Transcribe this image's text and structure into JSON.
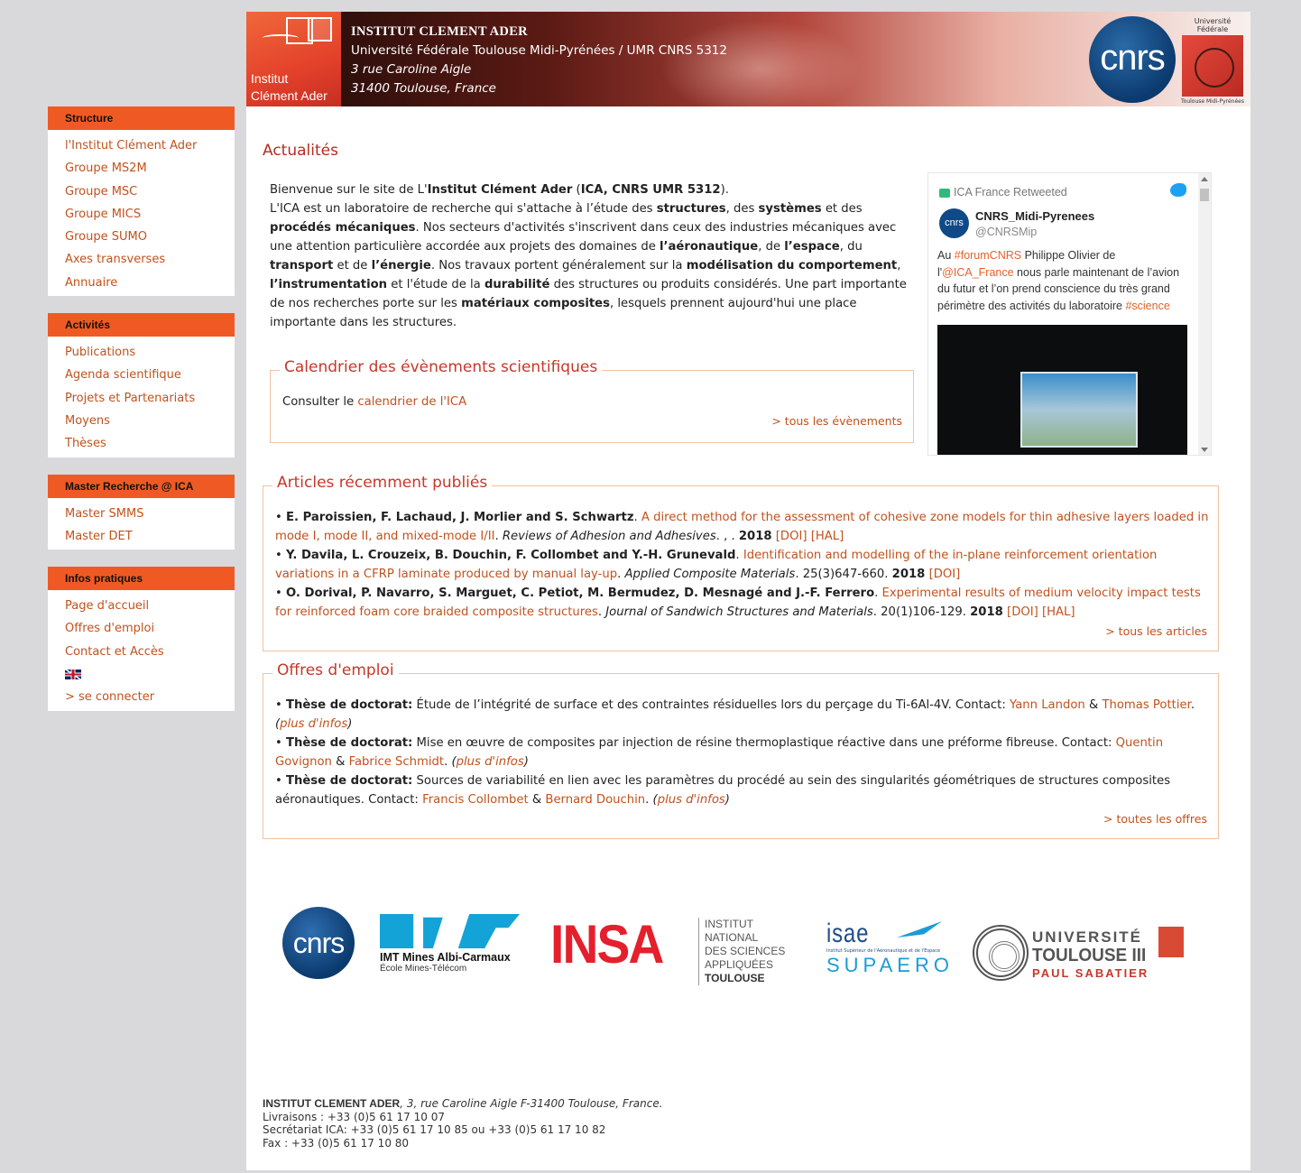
{
  "sidebar": {
    "boxes": [
      {
        "title": "Structure",
        "items": [
          "l'Institut Clément Ader",
          "Groupe MS2M",
          "Groupe MSC",
          "Groupe MICS",
          "Groupe SUMO",
          "Axes transverses",
          "Annuaire"
        ]
      },
      {
        "title": "Activités",
        "items": [
          "Publications",
          "Agenda scientifique",
          "Projets et Partenariats",
          "Moyens",
          "Thèses"
        ]
      },
      {
        "title": "Master Recherche @ ICA",
        "items": [
          "Master SMMS",
          "Master DET"
        ]
      },
      {
        "title": "Infos pratiques",
        "items": [
          "Page d'accueil",
          "Offres d'emploi",
          "Contact et Accès",
          "> se connecter"
        ]
      }
    ],
    "flag_icon": "uk-flag-icon"
  },
  "banner": {
    "logo_line1": "Institut",
    "logo_line2": "Clément Ader",
    "title": "INSTITUT CLEMENT ADER",
    "subtitle": "Université Fédérale Toulouse Midi-Pyrénées / UMR CNRS 5312",
    "address1": "3 rue Caroline Aigle",
    "address2": "31400 Toulouse, France",
    "cnrs_logo": "cnrs",
    "ufr_top": "Université Fédérale",
    "ufr_bottom": "Toulouse Midi-Pyrénées"
  },
  "page_title": "Actualités",
  "intro": {
    "p1_a": "Bienvenue sur le site de L'",
    "p1_b": "Institut Clément Ader",
    "p1_c": " (",
    "p1_d": "ICA, CNRS UMR 5312",
    "p1_e": ").",
    "s1": "L'ICA est un laboratoire de recherche qui s'attache à l’étude des ",
    "s2": "structures",
    "s3": ", des ",
    "s4": "systèmes",
    "s5": " et des ",
    "s6": "procédés mécaniques",
    "s7": ". Nos secteurs d'activités s'inscrivent dans ceux des industries mécaniques avec une attention particulière accordée aux projets des domaines de ",
    "s8": "l’aéronautique",
    "s9": ", de ",
    "s10": "l’espace",
    "s11": ", du ",
    "s12": "transport",
    "s13": " et de ",
    "s14": "l’énergie",
    "s15": ". Nos travaux portent généralement sur la ",
    "s16": "modélisation du comportement",
    "s17": ", ",
    "s18": "l’instrumentation",
    "s19": " et l'étude de la ",
    "s20": "durabilité",
    "s21": " des structures ou produits considérés. Une part importante de nos recherches porte sur les ",
    "s22": "matériaux composites",
    "s23": ", lesquels prennent aujourd'hui une place importante dans les structures."
  },
  "twitter": {
    "retweet": "ICA France Retweeted",
    "name": "CNRS_Midi-Pyrenees",
    "handle": "@CNRSMip",
    "avatar": "cnrs",
    "t1": "Au ",
    "t2": "#forumCNRS",
    "t3": " Philippe Olivier de l'",
    "t4": "@ICA_France",
    "t5": " nous parle maintenant de l’avion du futur et l’on prend conscience du très grand périmètre des activités du laboratoire ",
    "t6": "#science"
  },
  "calendar": {
    "legend": "Calendrier des évènements scientifiques",
    "text": "Consulter le ",
    "link": "calendrier de l'ICA",
    "more": "> tous les évènements"
  },
  "articles": {
    "legend": "Articles récemment publiés",
    "items": [
      {
        "authors": "E. Paroissien, F. Lachaud, J. Morlier and S. Schwartz",
        "title": "A direct method for the assessment of cohesive zone models for thin adhesive layers loaded in mode I, mode II, and mixed-mode I/II",
        "journal": "Reviews of Adhesion and Adhesives",
        "details": ". , . ",
        "year": "2018",
        "links": [
          "[DOI]",
          "[HAL]"
        ]
      },
      {
        "authors": "Y. Davila, L. Crouzeix, B. Douchin, F. Collombet and Y.-H. Grunevald",
        "title": "Identification and modelling of the in-plane reinforcement orientation variations in a CFRP laminate produced by manual lay-up",
        "journal": "Applied Composite Materials",
        "details": ". 25(3)647-660. ",
        "year": "2018",
        "links": [
          "[DOI]"
        ]
      },
      {
        "authors": "O. Dorival, P. Navarro, S. Marguet, C. Petiot, M. Bermudez, D. Mesnagé and J.-F. Ferrero",
        "title": "Experimental results of medium velocity impact tests for reinforced foam core braided composite structures",
        "journal": "Journal of Sandwich Structures and Materials",
        "details": ". 20(1)106-129. ",
        "year": "2018",
        "links": [
          "[DOI]",
          "[HAL]"
        ]
      }
    ],
    "more": "> tous les articles"
  },
  "jobs": {
    "legend": "Offres d'emploi",
    "label": "Thèse de doctorat:",
    "contact": " Contact: ",
    "amp": " & ",
    "plus": "plus d'infos",
    "items": [
      {
        "desc": "Étude de l’intégrité de surface et des contraintes résiduelles lors du perçage du Ti-6Al-4V.",
        "c1": "Yann Landon",
        "c2": "Thomas Pottier"
      },
      {
        "desc": "Mise en œuvre de composites par injection de résine thermoplastique réactive dans une préforme fibreuse.",
        "c1": "Quentin Govignon",
        "c2": "Fabrice Schmidt"
      },
      {
        "desc": "Sources de variabilité en lien avec les paramètres du procédé au sein des singularités géométriques de structures composites aéronautiques.",
        "c1": "Francis Collombet",
        "c2": "Bernard Douchin"
      }
    ],
    "more": "> toutes les offres"
  },
  "partners": {
    "cnrs": "cnrs",
    "imt_line1": "IMT Mines Albi-Carmaux",
    "imt_line2": "École Mines-Télécom",
    "insa_big": "INSA",
    "insa_small": [
      "INSTITUT NATIONAL",
      "DES SCIENCES",
      "APPLIQUÉES",
      "TOULOUSE"
    ],
    "isae": "isae",
    "isae_sub": "Institut Supérieur de l'Aéronautique et de l'Espace",
    "supaero": "SUPAERO",
    "ut3_1": "UNIVERSITÉ",
    "ut3_2": "TOULOUSE III",
    "ut3_3": "PAUL SABATIER"
  },
  "footer": {
    "name": "INSTITUT CLEMENT ADER",
    "address": ", 3, rue Caroline Aigle F-31400 Toulouse, France.",
    "l1": "Livraisons : +33 (0)5 61 17 10 07",
    "l2": "Secrétariat ICA: +33 (0)5 61 17 10 85 ou +33 (0)5 61 17 10 82",
    "l3": "Fax : +33 (0)5 61 17 10 80"
  }
}
